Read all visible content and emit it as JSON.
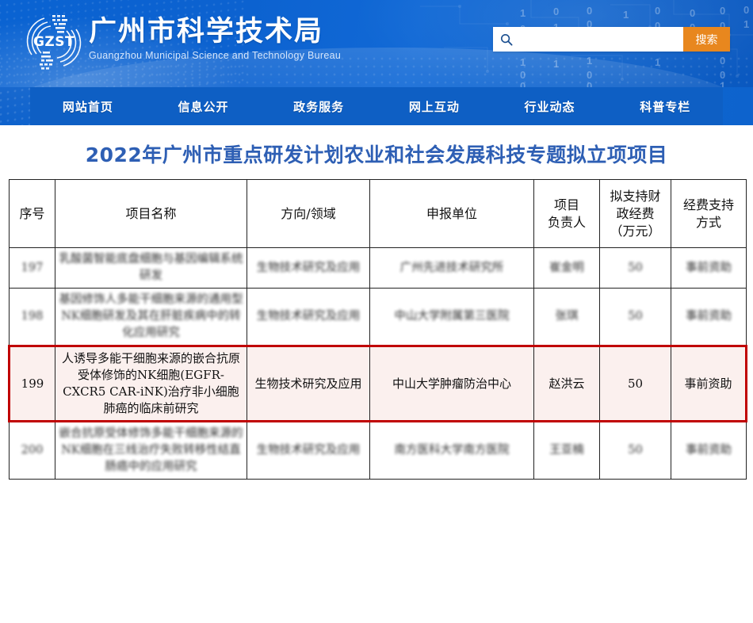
{
  "site": {
    "logo_text": "GZST",
    "name_cn": "广州市科学技术局",
    "name_en": "Guangzhou Municipal Science and Technology Bureau"
  },
  "search": {
    "value": "",
    "placeholder": "",
    "button_label": "搜索",
    "icon": "search-icon"
  },
  "nav": {
    "items": [
      {
        "label": "网站首页"
      },
      {
        "label": "信息公开"
      },
      {
        "label": "政务服务"
      },
      {
        "label": "网上互动"
      },
      {
        "label": "行业动态"
      },
      {
        "label": "科普专栏"
      }
    ]
  },
  "page": {
    "title": "2022年广州市重点研发计划农业和社会发展科技专题拟立项项目"
  },
  "table": {
    "headers": [
      "序号",
      "项目名称",
      "方向/领域",
      "申报单位",
      "项目\n负责人",
      "拟支持财\n政经费\n（万元）",
      "经费支持\n方式"
    ],
    "header_lines": {
      "no": "序号",
      "name": "项目名称",
      "field": "方向/领域",
      "org": "申报单位",
      "pi_l1": "项目",
      "pi_l2": "负责人",
      "fund_l1": "拟支持财",
      "fund_l2": "政经费",
      "fund_l3": "（万元）",
      "mode_l1": "经费支持",
      "mode_l2": "方式"
    },
    "rows": [
      {
        "no": "197",
        "name": "乳酸菌智能底盘细胞与基因编辑系统研发",
        "field": "生物技术研究及应用",
        "org": "广州先进技术研究所",
        "pi": "崔金明",
        "fund": "50",
        "mode": "事前资助",
        "redacted": true,
        "highlighted": false
      },
      {
        "no": "198",
        "name": "基因修饰人多能干细胞来源的通用型NK细胞研发及其在肝脏疾病中的转化应用研究",
        "field": "生物技术研究及应用",
        "org": "中山大学附属第三医院",
        "pi": "张琪",
        "fund": "50",
        "mode": "事前资助",
        "redacted": true,
        "highlighted": false
      },
      {
        "no": "199",
        "name": "人诱导多能干细胞来源的嵌合抗原受体修饰的NK细胞(EGFR-CXCR5 CAR-iNK)治疗非小细胞肺癌的临床前研究",
        "field": "生物技术研究及应用",
        "org": "中山大学肿瘤防治中心",
        "pi": "赵洪云",
        "fund": "50",
        "mode": "事前资助",
        "redacted": false,
        "highlighted": true
      },
      {
        "no": "200",
        "name": "嵌合抗原受体修饰多能干细胞来源的NK细胞在三线治疗失败转移性结直肠癌中的应用研究",
        "field": "生物技术研究及应用",
        "org": "南方医科大学南方医院",
        "pi": "王亚楠",
        "fund": "50",
        "mode": "事前资助",
        "redacted": true,
        "highlighted": false
      }
    ]
  },
  "colors": {
    "banner_blue": "#0c62d0",
    "nav_blue": "#0e5fc4",
    "search_button_orange": "#e8871e",
    "title_blue": "#2e5fb4",
    "highlight_border_red": "#c00000",
    "highlight_background": "#fbf0ee"
  },
  "decoration": {
    "binary_digits": "1 0 0 1 0 0 0 0 0 1 1 0 0 0 1 1 0 1 0 1 0 0 1 1 1 0 0 0 1 0 0 1"
  }
}
